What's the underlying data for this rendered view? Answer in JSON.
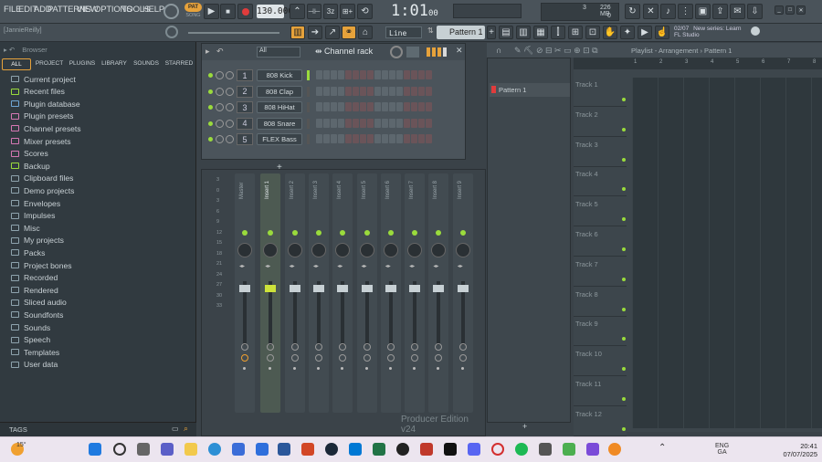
{
  "menu": [
    "FILE",
    "EDIT",
    "ADD",
    "PATTERNS",
    "VIEW",
    "OPTIONS",
    "TOOLS",
    "HELP"
  ],
  "transport": {
    "pat_label": "PAT",
    "song_label": "SONG",
    "tempo": "130.000",
    "time": "1:01",
    "time_sub": "00",
    "cpu_num": "3",
    "mem": "226 MB",
    "poly": "0"
  },
  "hint_text": "[JannieReilly]",
  "pattern_select": "Pattern 1",
  "snap_select": "Line",
  "news": {
    "date": "02/07",
    "line1": "New series: Learn",
    "line2": "FL Studio"
  },
  "browser": {
    "title": "Browser",
    "tabs": [
      "ALL",
      "PROJECT",
      "PLUGINS",
      "LIBRARY",
      "SOUNDS",
      "STARRED"
    ],
    "items": [
      "Current project",
      "Recent files",
      "Plugin database",
      "Plugin presets",
      "Channel presets",
      "Mixer presets",
      "Scores",
      "Backup",
      "Clipboard files",
      "Demo projects",
      "Envelopes",
      "Impulses",
      "Misc",
      "My projects",
      "Packs",
      "Project bones",
      "Recorded",
      "Rendered",
      "Sliced audio",
      "Soundfonts",
      "Sounds",
      "Speech",
      "Templates",
      "User data"
    ],
    "tags_label": "TAGS"
  },
  "channel_rack": {
    "title": "Channel rack",
    "filter": "All",
    "channels": [
      {
        "num": "1",
        "name": "808 Kick"
      },
      {
        "num": "2",
        "name": "808 Clap"
      },
      {
        "num": "3",
        "name": "808 HiHat"
      },
      {
        "num": "4",
        "name": "808 Snare"
      },
      {
        "num": "5",
        "name": "FLEX Bass"
      }
    ]
  },
  "mixer": {
    "db_ticks": [
      "3",
      "0",
      "3",
      "6",
      "9",
      "12",
      "15",
      "18",
      "21",
      "24",
      "27",
      "30",
      "33"
    ],
    "strips": [
      "Master",
      "Insert 1",
      "Insert 2",
      "Insert 3",
      "Insert 4",
      "Insert 5",
      "Insert 6",
      "Insert 7",
      "Insert 8",
      "Insert 9"
    ],
    "edition": "Producer Edition v24"
  },
  "pattern_list": {
    "items": [
      "Pattern 1"
    ]
  },
  "playlist": {
    "title": "Playlist - Arrangement › Pattern 1",
    "bars": [
      "1",
      "2",
      "3",
      "4",
      "5",
      "6",
      "7",
      "8"
    ],
    "tracks": [
      "Track 1",
      "Track 2",
      "Track 3",
      "Track 4",
      "Track 5",
      "Track 6",
      "Track 7",
      "Track 8",
      "Track 9",
      "Track 10",
      "Track 11",
      "Track 12"
    ]
  },
  "taskbar": {
    "weather": "15°",
    "lang1": "ENG",
    "lang2": "GA",
    "time": "20:41",
    "date": "07/07/2025"
  },
  "colors": {
    "accent": "#f0a030",
    "green": "#9adb3c",
    "red": "#e03c3c"
  }
}
